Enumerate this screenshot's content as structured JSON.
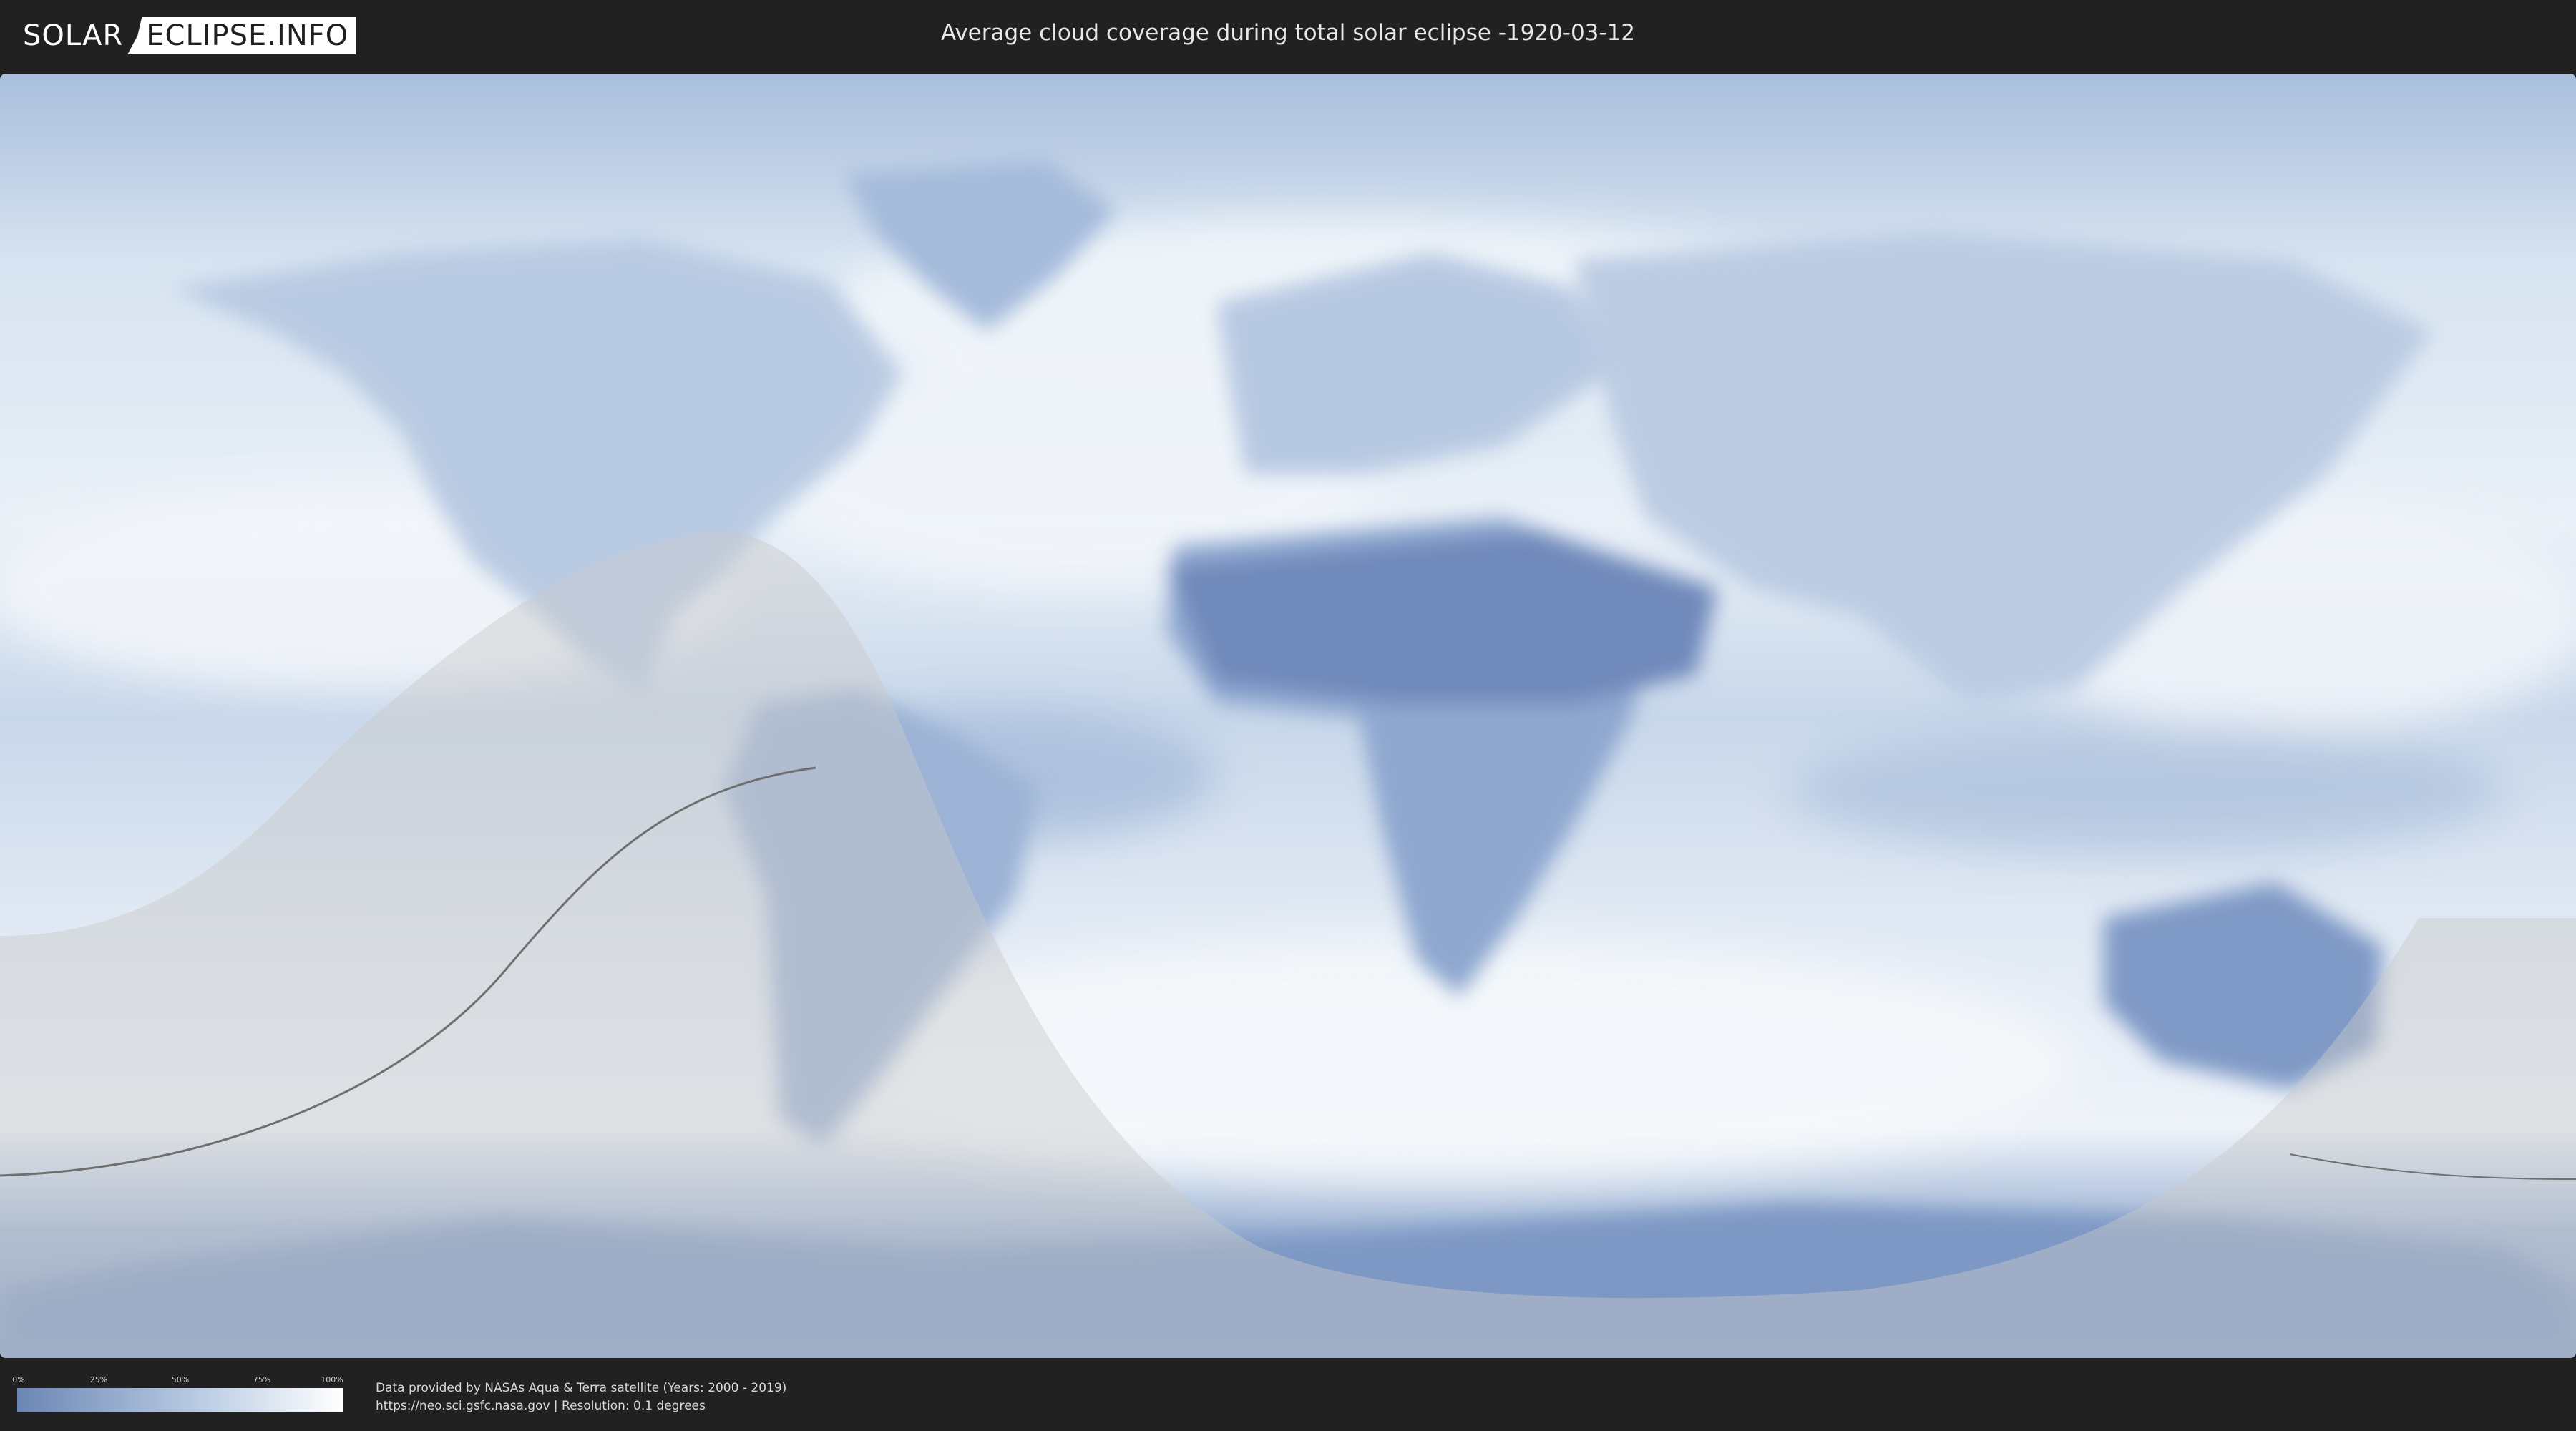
{
  "header": {
    "logo_part1": "SOLAR",
    "logo_part2": "ECLIPSE.INFO",
    "title": "Average cloud coverage during total solar eclipse -1920-03-12"
  },
  "legend": {
    "ticks": [
      "0%",
      "25%",
      "50%",
      "75%",
      "100%"
    ],
    "low_color": "#6a86b3",
    "high_color": "#ffffff"
  },
  "footer": {
    "source_line": "Data provided by NASAs Aqua & Terra satellite (Years: 2000 - 2019)",
    "url_line": "https://neo.sci.gsfc.nasa.gov | Resolution: 0.1 degrees"
  },
  "colors": {
    "ocean_cloud": "#dbe6f2",
    "land": "#97aed0",
    "dry_land": "#6d87b8",
    "overlay": "#cfcfcf",
    "path_line": "#6f6f6f"
  }
}
